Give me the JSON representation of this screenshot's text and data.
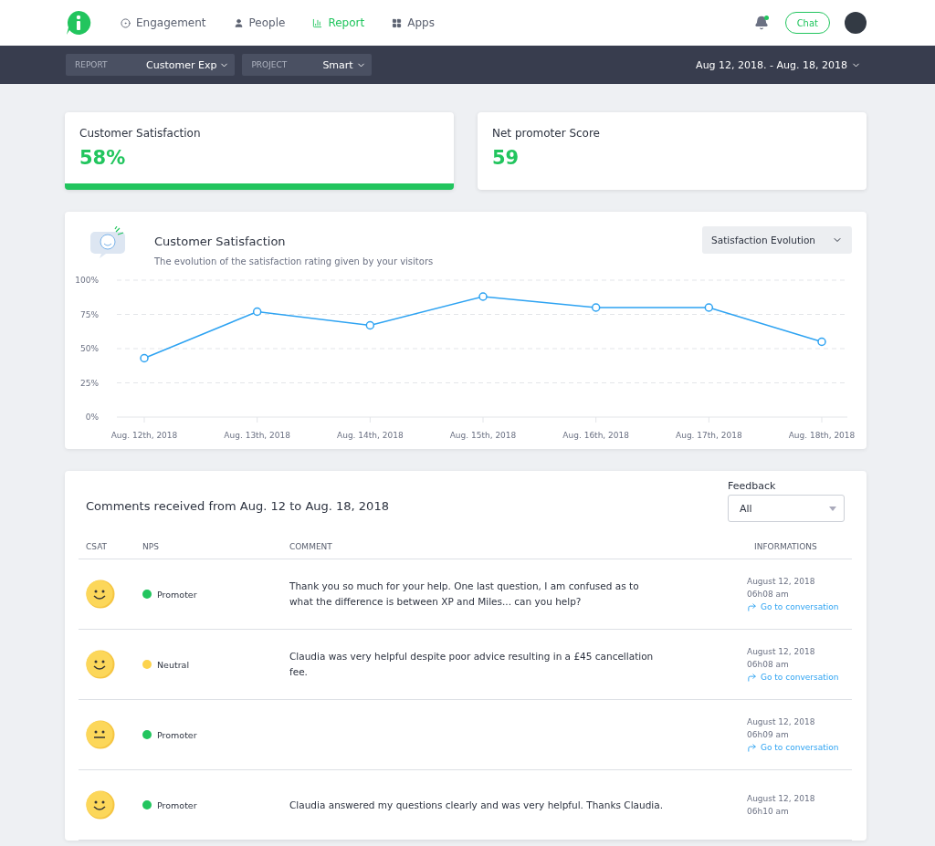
{
  "nav": {
    "items": [
      {
        "label": "Engagement",
        "kind": "target",
        "selected": false
      },
      {
        "label": "People",
        "kind": "person",
        "selected": false
      },
      {
        "label": "Report",
        "kind": "bars",
        "selected": true
      },
      {
        "label": "Apps",
        "kind": "grid",
        "selected": false
      }
    ],
    "chat": "Chat",
    "notification": true
  },
  "filters": [
    {
      "label": "REPORT",
      "value": "Customer Exp"
    },
    {
      "label": "PROJECT",
      "value": "Smart"
    }
  ],
  "date_range": "Aug 12, 2018. - Aug. 18, 2018",
  "kpis": [
    {
      "title": "Customer Satisfaction",
      "value": "58%",
      "selected": true
    },
    {
      "title": "Net promoter Score",
      "value": "59",
      "selected": false
    }
  ],
  "satisfaction": {
    "title": "Customer Satisfaction",
    "subtitle": "The evolution of the satisfaction rating given by your visitors",
    "view": "Satisfaction Evolution",
    "chart_data": {
      "type": "line",
      "categories": [
        "Aug. 12th, 2018",
        "Aug. 13th, 2018",
        "Aug. 14th, 2018",
        "Aug. 15th, 2018",
        "Aug. 16th, 2018",
        "Aug. 17th, 2018",
        "Aug. 18th, 2018"
      ],
      "grid": true,
      "series": [
        {
          "color": "#2ea3f2",
          "marker": "circle",
          "values": [
            43,
            77,
            67,
            88,
            80,
            80,
            55
          ]
        }
      ],
      "ylim": [
        0,
        100
      ],
      "yticks": [
        {
          "value": 0,
          "label": "0%"
        },
        {
          "value": 25,
          "label": "25%"
        },
        {
          "value": 50,
          "label": "50%"
        },
        {
          "value": 75,
          "label": "75%"
        },
        {
          "value": 100,
          "label": "100%"
        }
      ]
    }
  },
  "comments": {
    "title": "Comments received from Aug. 12 to Aug. 18, 2018",
    "filter_label": "Feedback",
    "filter_value": "All",
    "columns": [
      "CSAT",
      "NPS",
      "COMMENT",
      "INFORMATIONS"
    ],
    "rows": [
      {
        "kind": "happy",
        "nps": "Promoter",
        "color": "#22c55e",
        "comment": "Thank you so much for your help. One last question, I am confused as to what the difference is between XP and Miles... can you help?",
        "date": "August 12, 2018",
        "time": "06h08 am",
        "link": "Go to conversation"
      },
      {
        "kind": "happy",
        "nps": "Neutral",
        "color": "#fcd34d",
        "comment": "Claudia was very helpful despite poor advice resulting in a £45 cancellation fee.",
        "date": "August 12, 2018",
        "time": "06h08 am",
        "link": "Go to conversation"
      },
      {
        "kind": "neutral",
        "nps": "Promoter",
        "color": "#22c55e",
        "date": "August 12, 2018",
        "time": "06h09 am",
        "link": "Go to conversation"
      },
      {
        "kind": "happy",
        "nps": "Promoter",
        "color": "#22c55e",
        "comment": "Claudia answered my questions clearly and was very helpful. Thanks Claudia.",
        "date": "August 12, 2018",
        "time": "06h10 am"
      }
    ]
  }
}
